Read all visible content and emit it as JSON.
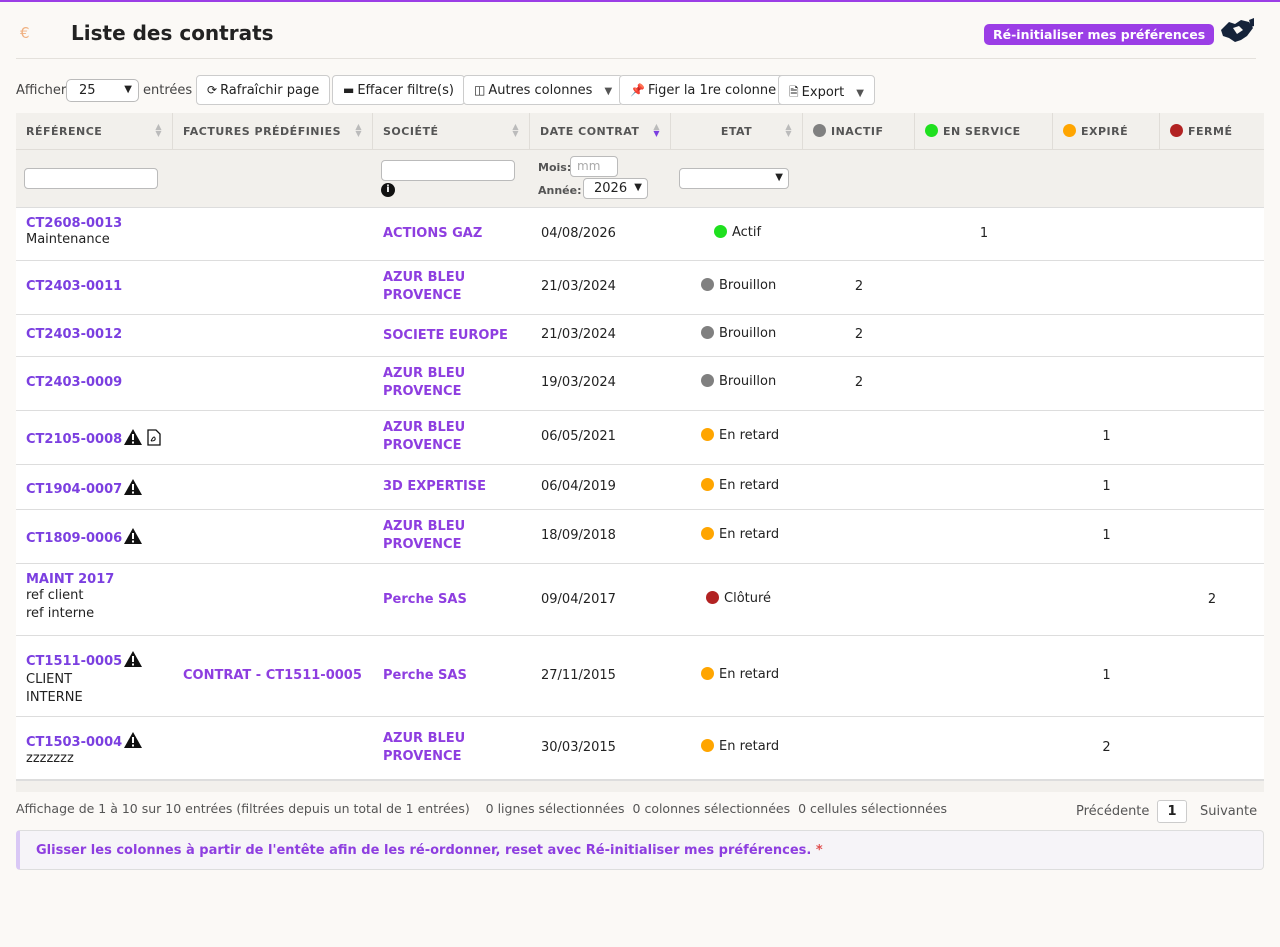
{
  "header": {
    "title": "Liste des contrats",
    "currency_symbol": "€",
    "reset_button": "Ré-initialiser mes préférences"
  },
  "toolbar": {
    "show_label": "Afficher",
    "page_size": "25",
    "entries_label": "entrées",
    "refresh": "Rafraîchir page",
    "clear_filters": "Effacer filtre(s)",
    "other_columns": "Autres colonnes",
    "freeze_column": "Figer la 1re colonne",
    "export": "Export"
  },
  "columns": {
    "reference": "RÉFÉRENCE",
    "predefined_invoices": "FACTURES PRÉDÉFINIES",
    "company": "SOCIÉTÉ",
    "contract_date": "DATE CONTRAT",
    "state": "ETAT",
    "inactive": "INACTIF",
    "in_service": "EN SERVICE",
    "expired": "EXPIRÉ",
    "closed": "FERMÉ"
  },
  "filters": {
    "month_label": "Mois:",
    "month_placeholder": "mm",
    "year_label": "Année:",
    "year_value": "2026"
  },
  "status_colors": {
    "active": "#1fe01f",
    "draft": "#808080",
    "late": "#ffa500",
    "closed": "#b22222",
    "accent": "#9b3ee6"
  },
  "rows": [
    {
      "ref": "CT2608-0013",
      "sub1": "Maintenance",
      "sub2": "",
      "invoice": "",
      "company1": "ACTIONS GAZ",
      "company2": "",
      "date": "04/08/2026",
      "state": "Actif",
      "inactif": "",
      "service": "1",
      "expire": "",
      "ferme": ""
    },
    {
      "ref": "CT2403-0011",
      "sub1": "",
      "sub2": "",
      "invoice": "",
      "company1": "AZUR BLEU",
      "company2": "PROVENCE",
      "date": "21/03/2024",
      "state": "Brouillon",
      "inactif": "2",
      "service": "",
      "expire": "",
      "ferme": ""
    },
    {
      "ref": "CT2403-0012",
      "sub1": "",
      "sub2": "",
      "invoice": "",
      "company1": "SOCIETE EUROPE",
      "company2": "",
      "date": "21/03/2024",
      "state": "Brouillon",
      "inactif": "2",
      "service": "",
      "expire": "",
      "ferme": ""
    },
    {
      "ref": "CT2403-0009",
      "sub1": "",
      "sub2": "",
      "invoice": "",
      "company1": "AZUR BLEU",
      "company2": "PROVENCE",
      "date": "19/03/2024",
      "state": "Brouillon",
      "inactif": "2",
      "service": "",
      "expire": "",
      "ferme": ""
    },
    {
      "ref": "CT2105-0008",
      "sub1": "",
      "sub2": "",
      "invoice": "",
      "company1": "AZUR BLEU",
      "company2": "PROVENCE",
      "date": "06/05/2021",
      "state": "En retard",
      "inactif": "",
      "service": "",
      "expire": "1",
      "ferme": ""
    },
    {
      "ref": "CT1904-0007",
      "sub1": "",
      "sub2": "",
      "invoice": "",
      "company1": "3D EXPERTISE",
      "company2": "",
      "date": "06/04/2019",
      "state": "En retard",
      "inactif": "",
      "service": "",
      "expire": "1",
      "ferme": ""
    },
    {
      "ref": "CT1809-0006",
      "sub1": "",
      "sub2": "",
      "invoice": "",
      "company1": "AZUR BLEU",
      "company2": "PROVENCE",
      "date": "18/09/2018",
      "state": "En retard",
      "inactif": "",
      "service": "",
      "expire": "1",
      "ferme": ""
    },
    {
      "ref": "MAINT 2017",
      "sub1": "ref client",
      "sub2": "ref interne",
      "invoice": "",
      "company1": "Perche SAS",
      "company2": "",
      "date": "09/04/2017",
      "state": "Clôturé",
      "inactif": "",
      "service": "",
      "expire": "",
      "ferme": "2"
    },
    {
      "ref": "CT1511-0005",
      "sub1": "CLIENT",
      "sub2": "INTERNE",
      "invoice": "CONTRAT - CT1511-0005",
      "company1": "Perche SAS",
      "company2": "",
      "date": "27/11/2015",
      "state": "En retard",
      "inactif": "",
      "service": "",
      "expire": "1",
      "ferme": ""
    },
    {
      "ref": "CT1503-0004",
      "sub1": "zzzzzzz",
      "sub2": "",
      "invoice": "",
      "company1": "AZUR BLEU",
      "company2": "PROVENCE",
      "date": "30/03/2015",
      "state": "En retard",
      "inactif": "",
      "service": "",
      "expire": "2",
      "ferme": ""
    }
  ],
  "footer": {
    "info": "Affichage de 1 à 10 sur 10 entrées (filtrées depuis un total de 1 entrées)",
    "rows_selected": "0 lignes sélectionnées",
    "cols_selected": "0 colonnes sélectionnées",
    "cells_selected": "0 cellules sélectionnées",
    "previous": "Précédente",
    "page": "1",
    "next": "Suivante"
  },
  "notice": {
    "text": "Glisser les colonnes à partir de l'entête afin de les ré-ordonner, reset avec Ré-initialiser mes préférences.",
    "star": "*"
  }
}
